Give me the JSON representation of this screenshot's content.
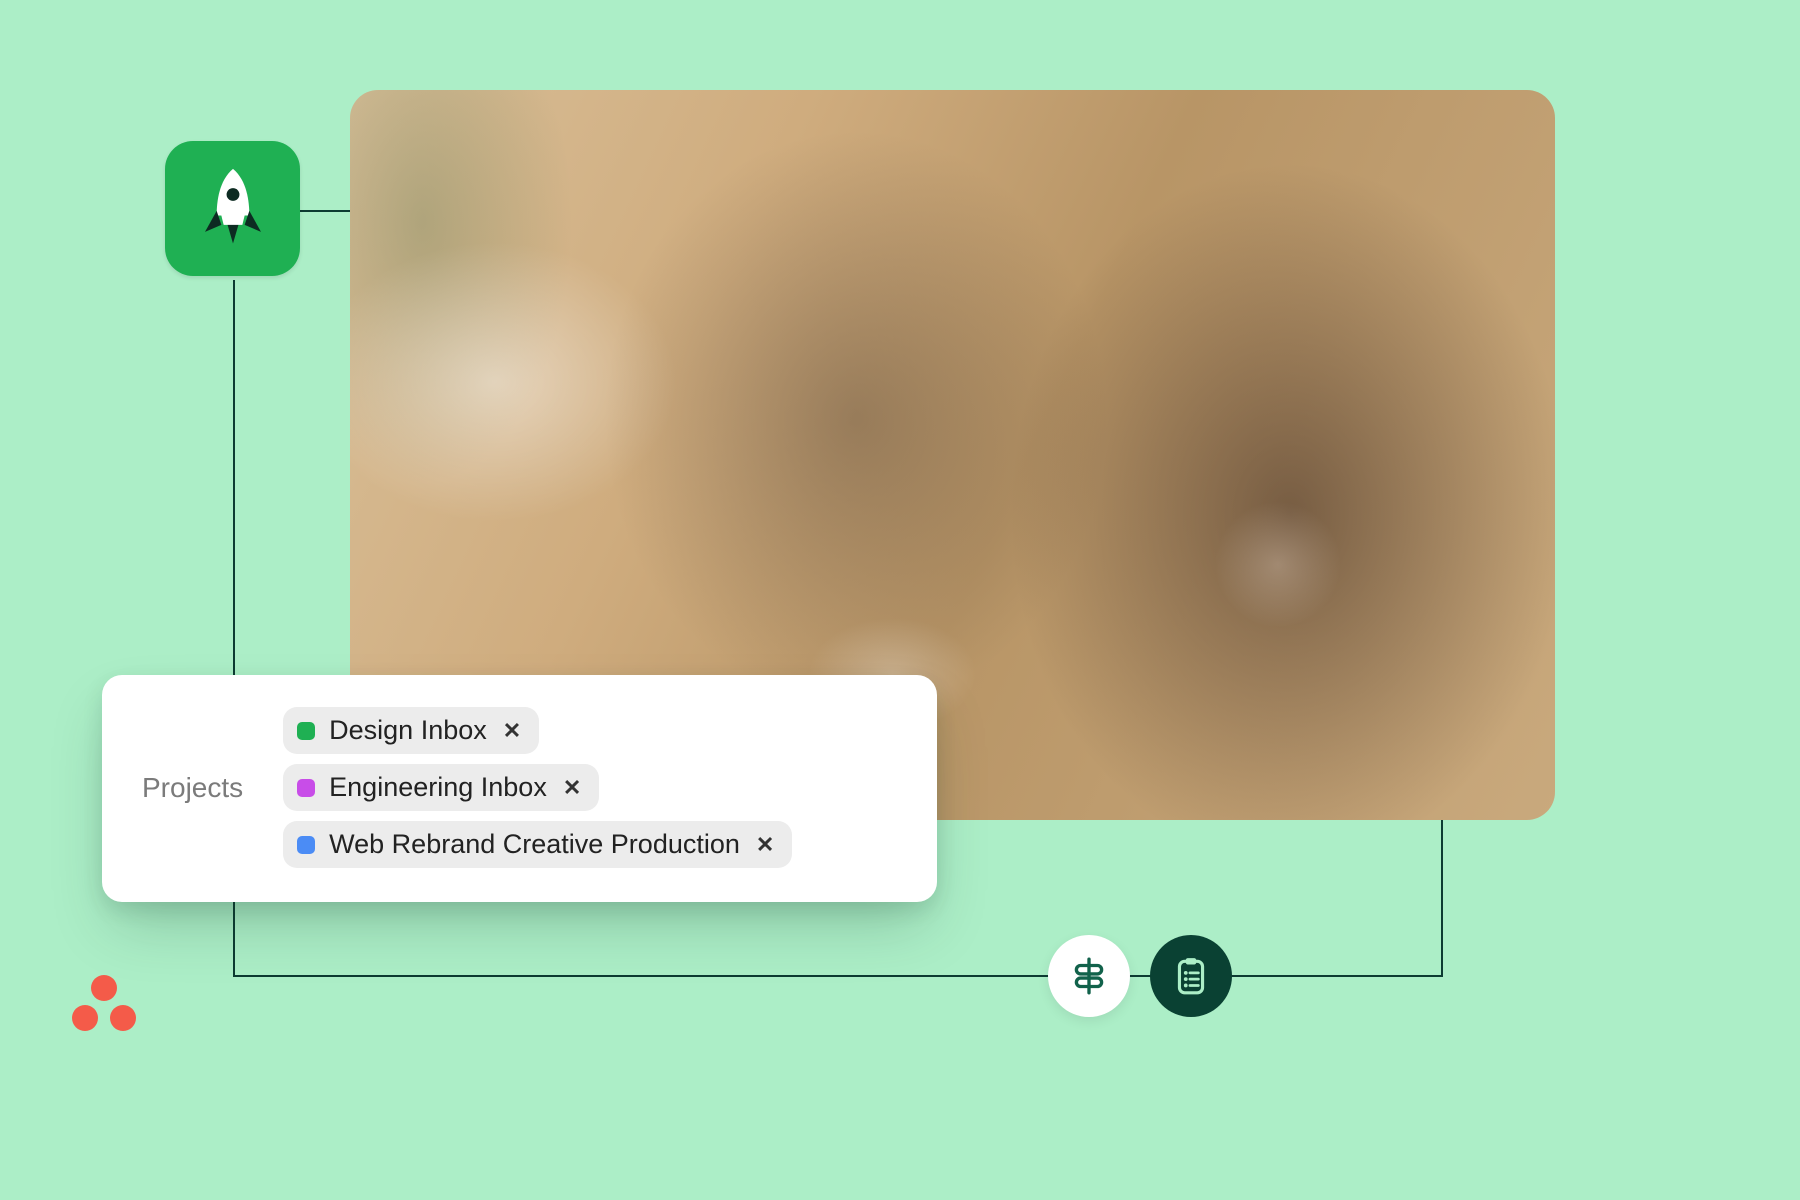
{
  "colors": {
    "bg": "#aceec7",
    "rocket_tile": "#1fb053",
    "line": "#0d3b32",
    "pill_dark": "#0a4133",
    "logo": "#f45b49"
  },
  "icons": {
    "rocket": "rocket-icon",
    "form": "form-icon",
    "clipboard": "clipboard-list-icon",
    "logo": "three-dots-logo"
  },
  "projects": {
    "label": "Projects",
    "chips": [
      {
        "name": "Design Inbox",
        "color": "#1fb053"
      },
      {
        "name": "Engineering Inbox",
        "color": "#c84de8"
      },
      {
        "name": "Web Rebrand Creative Production",
        "color": "#4b8cf5"
      }
    ]
  }
}
